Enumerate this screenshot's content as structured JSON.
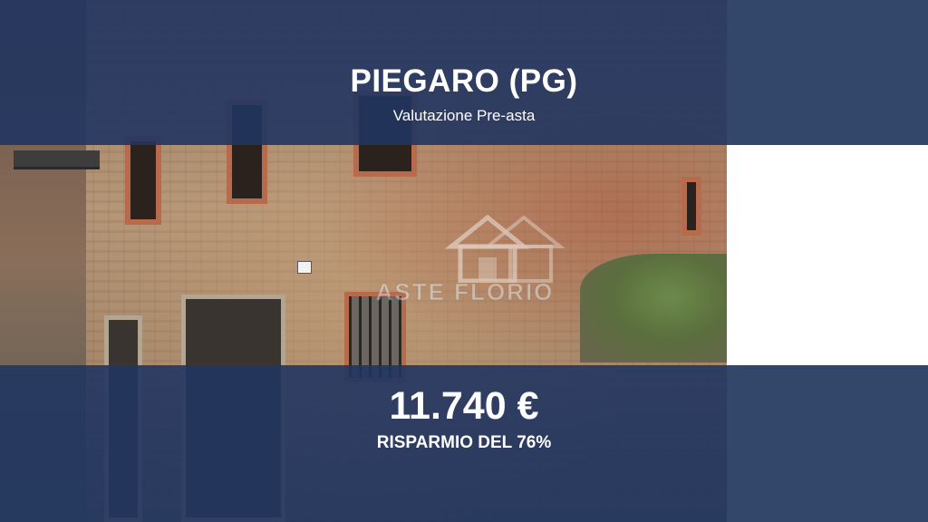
{
  "listing": {
    "title": "PIEGARO (PG)",
    "subtitle": "Valutazione Pre-asta",
    "price": "11.740 €",
    "saving": "RISPARMIO DEL 76%"
  },
  "photo": {
    "watermark_text": "ASTE FLORIO"
  },
  "colors": {
    "overlay_band": "#213560",
    "side_panel": "#33476a",
    "text": "#ffffff"
  }
}
